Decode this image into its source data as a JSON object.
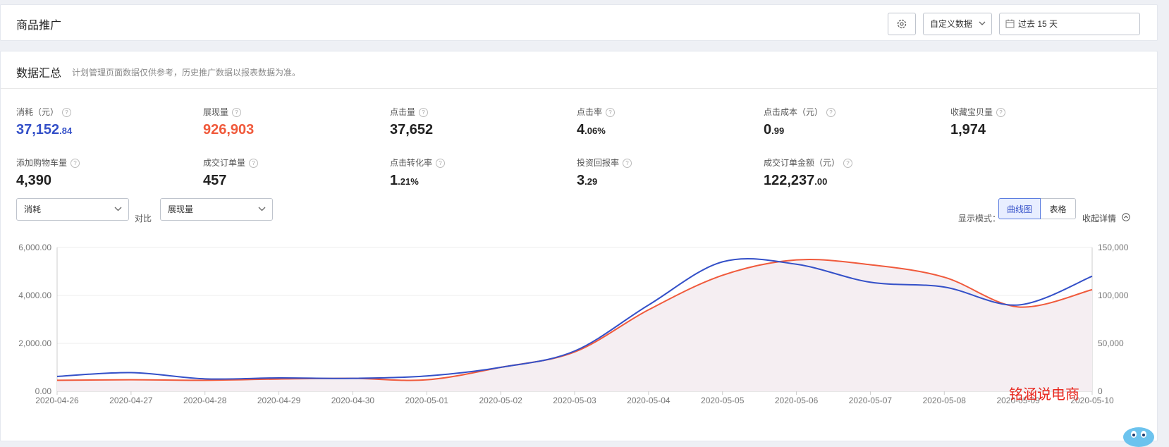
{
  "header": {
    "title": "商品推广",
    "settings_icon": "gear-icon",
    "custom_data_label": "自定义数据",
    "date_range_label": "过去 15 天",
    "calendar_icon": "calendar-icon"
  },
  "summary": {
    "title": "数据汇总",
    "note": "计划管理页面数据仅供参考，历史推广数据以报表数据为准。",
    "help_glyph": "?",
    "metrics": [
      {
        "label": "消耗（元）",
        "int": "37,152",
        "frac": ".84"
      },
      {
        "label": "展现量",
        "int": "926,903",
        "frac": ""
      },
      {
        "label": "点击量",
        "int": "37,652",
        "frac": ""
      },
      {
        "label": "点击率",
        "int": "4",
        "frac": ".06%"
      },
      {
        "label": "点击成本（元）",
        "int": "0",
        "frac": ".99"
      },
      {
        "label": "收藏宝贝量",
        "int": "1,974",
        "frac": ""
      },
      {
        "label": "添加购物车量",
        "int": "4,390",
        "frac": ""
      },
      {
        "label": "成交订单量",
        "int": "457",
        "frac": ""
      },
      {
        "label": "点击转化率",
        "int": "1",
        "frac": ".21%"
      },
      {
        "label": "投资回报率",
        "int": "3",
        "frac": ".29"
      },
      {
        "label": "成交订单金额（元）",
        "int": "122,237",
        "frac": ".00"
      }
    ]
  },
  "controls": {
    "metric_a": "消耗",
    "compare_label": "对比",
    "metric_b": "展现量",
    "display_mode_label": "显示模式：",
    "mode_curve": "曲线图",
    "mode_table": "表格",
    "collapse_label": "收起详情"
  },
  "watermark": "铭涵说电商",
  "colors": {
    "series_a": "#3450c8",
    "series_b": "#f05a3c",
    "area_fill": "#f5eef2",
    "accent": "#3450c8"
  },
  "chart_data": {
    "type": "line",
    "x": [
      "2020-04-26",
      "2020-04-27",
      "2020-04-28",
      "2020-04-29",
      "2020-04-30",
      "2020-05-01",
      "2020-05-02",
      "2020-05-03",
      "2020-05-04",
      "2020-05-05",
      "2020-05-06",
      "2020-05-07",
      "2020-05-08",
      "2020-05-09",
      "2020-05-10"
    ],
    "series": [
      {
        "name": "消耗",
        "axis": "left",
        "values": [
          620,
          780,
          520,
          560,
          540,
          640,
          1000,
          1680,
          3600,
          5400,
          5300,
          4550,
          4350,
          3600,
          4800
        ]
      },
      {
        "name": "展现量",
        "axis": "right",
        "values": [
          11500,
          12000,
          11500,
          12800,
          13500,
          12000,
          25000,
          41000,
          85000,
          121000,
          137000,
          132000,
          119000,
          88000,
          106000
        ]
      }
    ],
    "y_left": {
      "ylim": [
        0,
        6000
      ],
      "ticks": [
        "0.00",
        "2,000.00",
        "4,000.00",
        "6,000.00"
      ]
    },
    "y_right": {
      "ylim": [
        0,
        150000
      ],
      "ticks": [
        "0",
        "50,000",
        "100,000",
        "150,000"
      ]
    },
    "grid": true,
    "area_fill_series": "展现量"
  }
}
